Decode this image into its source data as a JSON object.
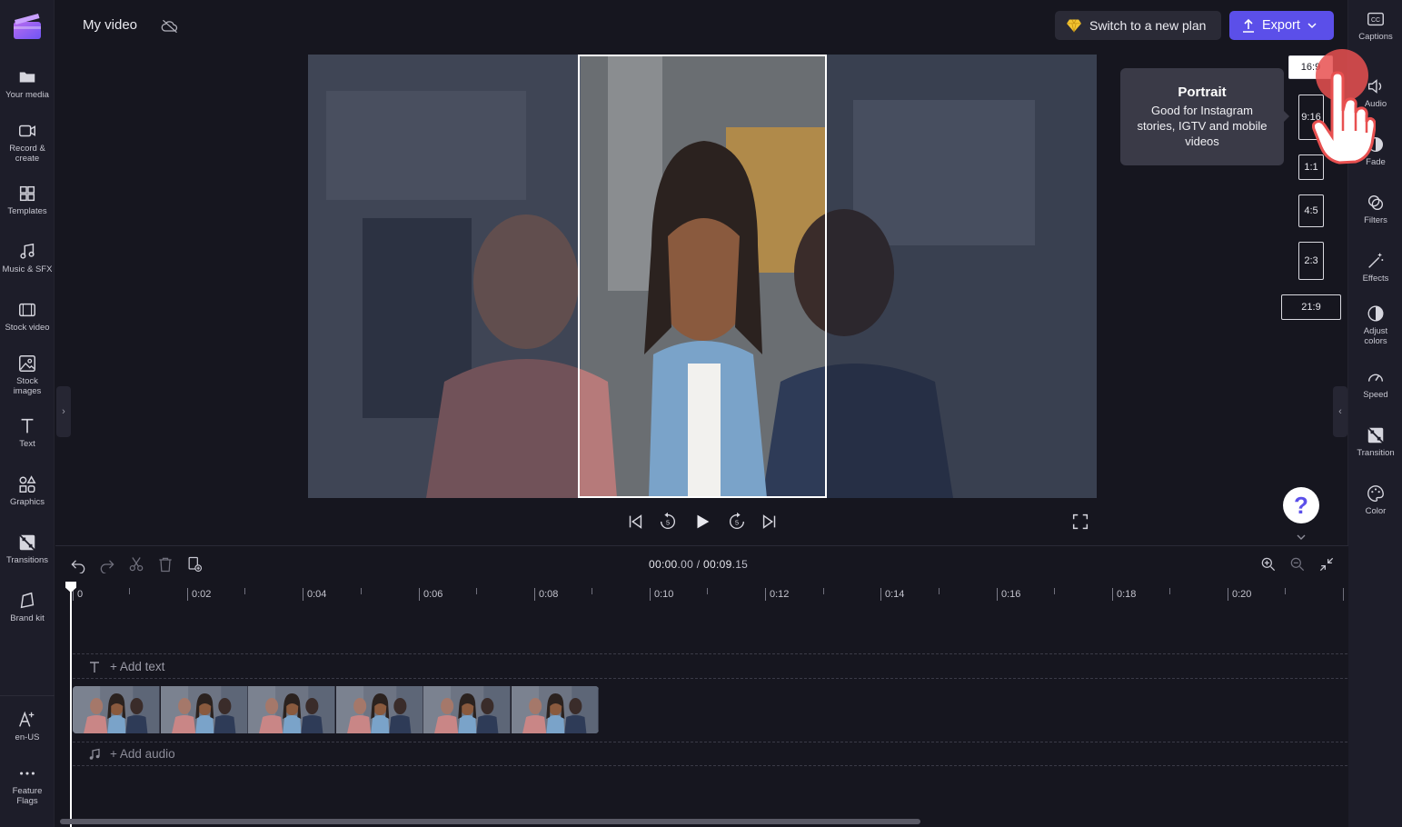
{
  "header": {
    "project_title": "My video",
    "plan_button": "Switch to a new plan",
    "export_button": "Export"
  },
  "left_sidebar": {
    "items": [
      {
        "label": "Your media"
      },
      {
        "label": "Record &\ncreate"
      },
      {
        "label": "Templates"
      },
      {
        "label": "Music & SFX"
      },
      {
        "label": "Stock video"
      },
      {
        "label": "Stock\nimages"
      },
      {
        "label": "Text"
      },
      {
        "label": "Graphics"
      },
      {
        "label": "Transitions"
      },
      {
        "label": "Brand kit"
      }
    ],
    "bottom_items": [
      {
        "label": "en-US"
      },
      {
        "label": "Feature\nFlags"
      }
    ]
  },
  "right_sidebar": {
    "items": [
      {
        "label": "Captions"
      },
      {
        "label": "Audio"
      },
      {
        "label": "Fade"
      },
      {
        "label": "Filters"
      },
      {
        "label": "Effects"
      },
      {
        "label": "Adjust\ncolors"
      },
      {
        "label": "Speed"
      },
      {
        "label": "Transition"
      },
      {
        "label": "Color"
      }
    ]
  },
  "tooltip": {
    "title": "Portrait",
    "text": "Good for Instagram stories, IGTV and mobile videos"
  },
  "aspect_ratios": {
    "options": [
      "16:9",
      "9:16",
      "1:1",
      "4:5",
      "2:3",
      "21:9"
    ],
    "selected": "16:9"
  },
  "help": {
    "label": "?"
  },
  "timeline": {
    "current_time": "00:00",
    "current_frac": ".00",
    "separator": " / ",
    "total_time": "00:09",
    "total_frac": ".15",
    "ruler": [
      "0",
      "0:02",
      "0:04",
      "0:06",
      "0:08",
      "0:10",
      "0:12",
      "0:14",
      "0:16",
      "0:18",
      "0:20"
    ],
    "add_text": "+ Add text",
    "add_audio": "+ Add audio",
    "clip_thumbnail_count": 6
  },
  "colors": {
    "accent": "#5b4fe9",
    "background": "#16161f",
    "panel": "#1d1d29",
    "click_indicator": "#e85050"
  }
}
